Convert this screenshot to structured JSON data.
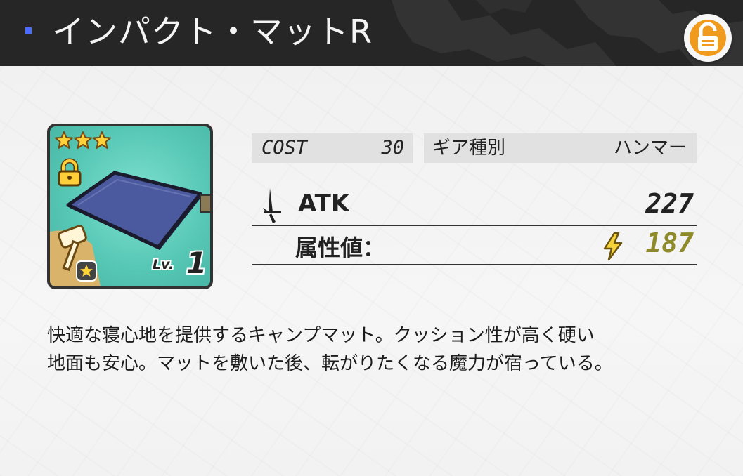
{
  "header": {
    "title": "インパクト・マットR",
    "lock_icon": "unlocked-padlock-icon",
    "accent_color": "#f09a1e",
    "marker_color": "#4a6cff"
  },
  "gear": {
    "rarity_stars": 3,
    "lock_icon": "unlocked-padlock-icon",
    "category_icon": "hammer-icon",
    "element_icon": "star-badge-icon",
    "level_label": "Lv.",
    "level_value": "1",
    "card_color": "#58c8b6"
  },
  "stats": {
    "cost_label": "COST",
    "cost_value": "30",
    "type_label": "ギア種別",
    "type_value": "ハンマー",
    "atk_icon": "sword-icon",
    "atk_label": "ATK",
    "atk_value": "227",
    "attribute_label": "属性値：",
    "attribute_icon": "lightning-bolt-icon",
    "attribute_value": "187",
    "attribute_color": "#8e8a2a"
  },
  "description": {
    "line1": "快適な寝心地を提供するキャンプマット。クッション性が高く硬い",
    "line2": "地面も安心。マットを敷いた後、転がりたくなる魔力が宿っている。"
  }
}
